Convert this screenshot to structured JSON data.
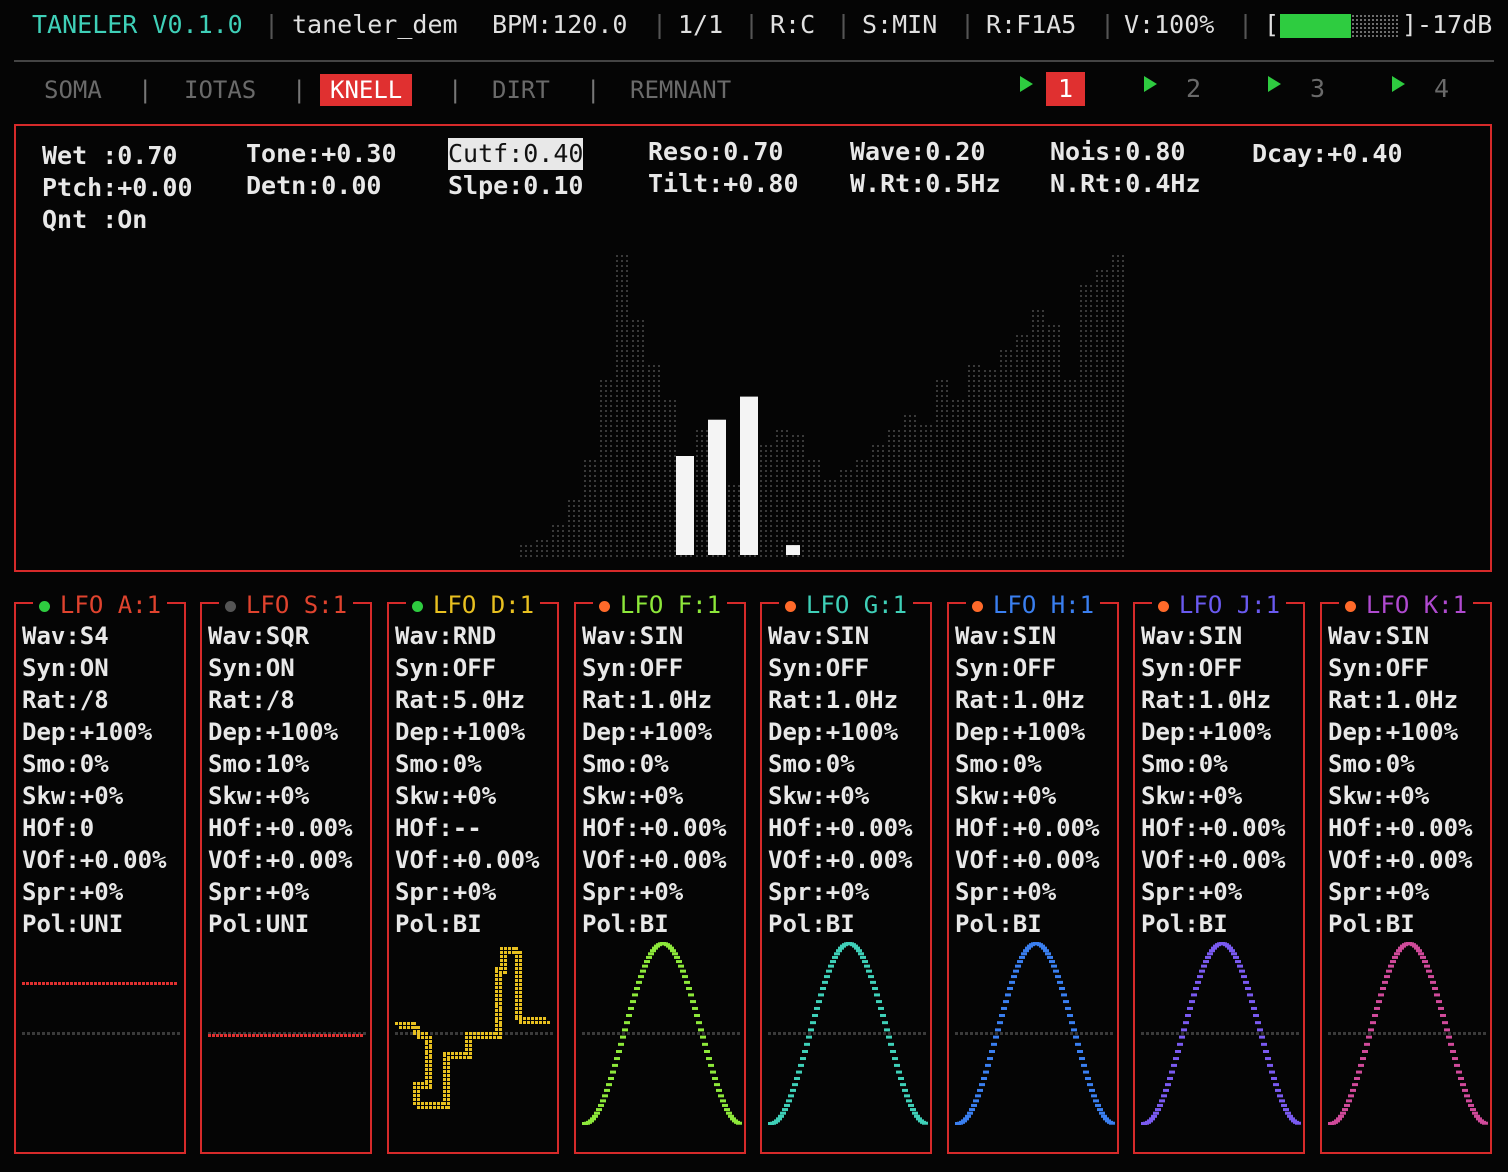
{
  "header": {
    "title": "TANELER V0.1.0",
    "project": "taneler_dem",
    "bpm": "BPM:120.0",
    "meter": "1/1",
    "root": "R:C",
    "scale": "S:MIN",
    "rand": "R:F1A5",
    "volume": "V:100%",
    "vu_open": "[",
    "vu_close": "]-17dB",
    "vu_level": 0.6,
    "title_color": "#3fd0b8",
    "separator": "|"
  },
  "tabs": [
    {
      "label": "SOMA",
      "active": false
    },
    {
      "label": "IOTAS",
      "active": false
    },
    {
      "label": "KNELL",
      "active": true
    },
    {
      "label": "DIRT",
      "active": false
    },
    {
      "label": "REMNANT",
      "active": false
    }
  ],
  "patterns": [
    {
      "label": "1",
      "active": true
    },
    {
      "label": "2",
      "active": false
    },
    {
      "label": "3",
      "active": false
    },
    {
      "label": "4",
      "active": false
    }
  ],
  "knell": {
    "params": [
      {
        "text": "Wet :0.70",
        "selected": false
      },
      {
        "text": "Ptch:+0.00",
        "selected": false
      },
      {
        "text": "Qnt :On",
        "selected": false
      },
      {
        "text": "Tone:+0.30",
        "selected": false
      },
      {
        "text": "Detn:0.00",
        "selected": false
      },
      {
        "text": "Cutf:0.40",
        "selected": true
      },
      {
        "text": "Slpe:0.10",
        "selected": false
      },
      {
        "text": "Reso:0.70",
        "selected": false
      },
      {
        "text": "Tilt:+0.80",
        "selected": false
      },
      {
        "text": "Wave:0.20",
        "selected": false
      },
      {
        "text": "W.Rt:0.5Hz",
        "selected": false
      },
      {
        "text": "Nois:0.80",
        "selected": false
      },
      {
        "text": "N.Rt:0.4Hz",
        "selected": false
      },
      {
        "text": "Dcay:+0.40",
        "selected": false
      }
    ],
    "spectrum_levels": [
      0.04,
      0.06,
      0.1,
      0.18,
      0.3,
      0.55,
      0.95,
      0.75,
      0.6,
      0.5,
      0.3,
      0.4,
      0.3,
      0.22,
      0.3,
      0.35,
      0.4,
      0.38,
      0.3,
      0.25,
      0.28,
      0.3,
      0.35,
      0.4,
      0.45,
      0.42,
      0.55,
      0.5,
      0.6,
      0.58,
      0.65,
      0.7,
      0.78,
      0.72,
      0.55,
      0.85,
      0.9,
      0.95
    ],
    "spectrum_highlight": [
      0.3,
      0.41,
      0.48,
      0.03
    ]
  },
  "lfos": [
    {
      "title": "LFO A:1",
      "dot": "#2ecc40",
      "title_color": "#e0432e",
      "wave_color": "#e03030",
      "params": [
        "Wav:S4",
        "Syn:ON",
        "Rat:/8",
        "Dep:+100%",
        "Smo:0%",
        "Skw:+0%",
        "HOf:0",
        "VOf:+0.00%",
        "Spr:+0%",
        "Pol:UNI"
      ],
      "shape": "flat_high"
    },
    {
      "title": "LFO S:1",
      "dot": "#555555",
      "title_color": "#e0432e",
      "wave_color": "#e03030",
      "params": [
        "Wav:SQR",
        "Syn:ON",
        "Rat:/8",
        "Dep:+100%",
        "Smo:10%",
        "Skw:+0%",
        "HOf:+0.00%",
        "VOf:+0.00%",
        "Spr:+0%",
        "Pol:UNI"
      ],
      "shape": "flat_low"
    },
    {
      "title": "LFO D:1",
      "dot": "#2ecc40",
      "title_color": "#e8c020",
      "wave_color": "#e8c020",
      "params": [
        "Wav:RND",
        "Syn:OFF",
        "Rat:5.0Hz",
        "Dep:+100%",
        "Smo:0%",
        "Skw:+0%",
        "HOf:--",
        "VOf:+0.00%",
        "Spr:+0%",
        "Pol:BI"
      ],
      "shape": "random"
    },
    {
      "title": "LFO F:1",
      "dot": "#ff6a2a",
      "title_color": "#8de83a",
      "wave_color": "#8de83a",
      "params": [
        "Wav:SIN",
        "Syn:OFF",
        "Rat:1.0Hz",
        "Dep:+100%",
        "Smo:0%",
        "Skw:+0%",
        "HOf:+0.00%",
        "VOf:+0.00%",
        "Spr:+0%",
        "Pol:BI"
      ],
      "shape": "sine"
    },
    {
      "title": "LFO G:1",
      "dot": "#ff6a2a",
      "title_color": "#3fd0b8",
      "wave_color": "#3fd0b8",
      "params": [
        "Wav:SIN",
        "Syn:OFF",
        "Rat:1.0Hz",
        "Dep:+100%",
        "Smo:0%",
        "Skw:+0%",
        "HOf:+0.00%",
        "VOf:+0.00%",
        "Spr:+0%",
        "Pol:BI"
      ],
      "shape": "sine"
    },
    {
      "title": "LFO H:1",
      "dot": "#ff6a2a",
      "title_color": "#3a7ff0",
      "wave_color": "#3a7ff0",
      "params": [
        "Wav:SIN",
        "Syn:OFF",
        "Rat:1.0Hz",
        "Dep:+100%",
        "Smo:0%",
        "Skw:+0%",
        "HOf:+0.00%",
        "VOf:+0.00%",
        "Spr:+0%",
        "Pol:BI"
      ],
      "shape": "sine"
    },
    {
      "title": "LFO J:1",
      "dot": "#ff6a2a",
      "title_color": "#6a5af0",
      "wave_color": "#7a5af0",
      "params": [
        "Wav:SIN",
        "Syn:OFF",
        "Rat:1.0Hz",
        "Dep:+100%",
        "Smo:0%",
        "Skw:+0%",
        "HOf:+0.00%",
        "VOf:+0.00%",
        "Spr:+0%",
        "Pol:BI"
      ],
      "shape": "sine"
    },
    {
      "title": "LFO K:1",
      "dot": "#ff6a2a",
      "title_color": "#b04ad0",
      "wave_color": "#d04a9a",
      "params": [
        "Wav:SIN",
        "Syn:OFF",
        "Rat:1.0Hz",
        "Dep:+100%",
        "Smo:0%",
        "Skw:+0%",
        "HOf:+0.00%",
        "VOf:+0.00%",
        "Spr:+0%",
        "Pol:BI"
      ],
      "shape": "sine"
    }
  ]
}
